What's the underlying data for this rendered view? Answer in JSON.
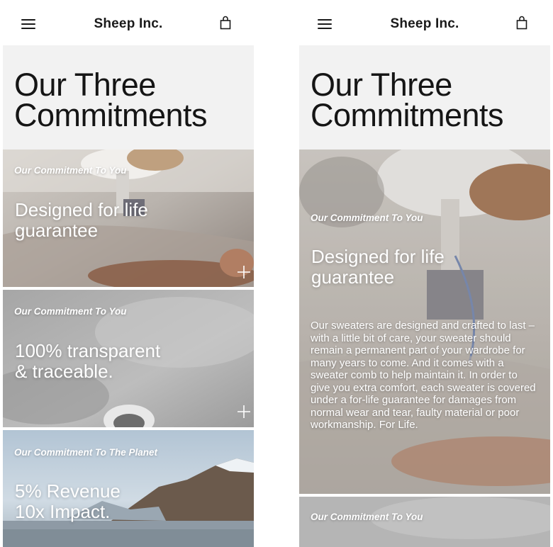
{
  "app": {
    "brand": "Sheep Inc."
  },
  "icons": {
    "menu": "hamburger-menu-icon",
    "bag": "shopping-bag-icon",
    "expand": "plus-icon"
  },
  "colors": {
    "text_dark": "#151515",
    "hero_bg": "#f2f2f2",
    "card_text": "#ffffff"
  },
  "page": {
    "title": "Our Three Commitments"
  },
  "commitments": [
    {
      "eyebrow": "Our Commitment To You",
      "title_line1": "Designed for life",
      "title_line2": "guarantee",
      "description": "Our sweaters are designed and crafted to last – with a little bit of care, your sweater should remain a permanent part of your wardrobe for many years to come. And it comes with a sweater comb to help maintain it. In order to give you extra comfort, each sweater is covered under a for-life guarantee for damages from normal wear and tear, faulty material or poor workmanship. For Life."
    },
    {
      "eyebrow": "Our Commitment To You",
      "title_line1": "100% transparent",
      "title_line2": "& traceable."
    },
    {
      "eyebrow": "Our Commitment To The Planet",
      "title_line1": "5% Revenue",
      "title_line2": "10x Impact."
    }
  ]
}
